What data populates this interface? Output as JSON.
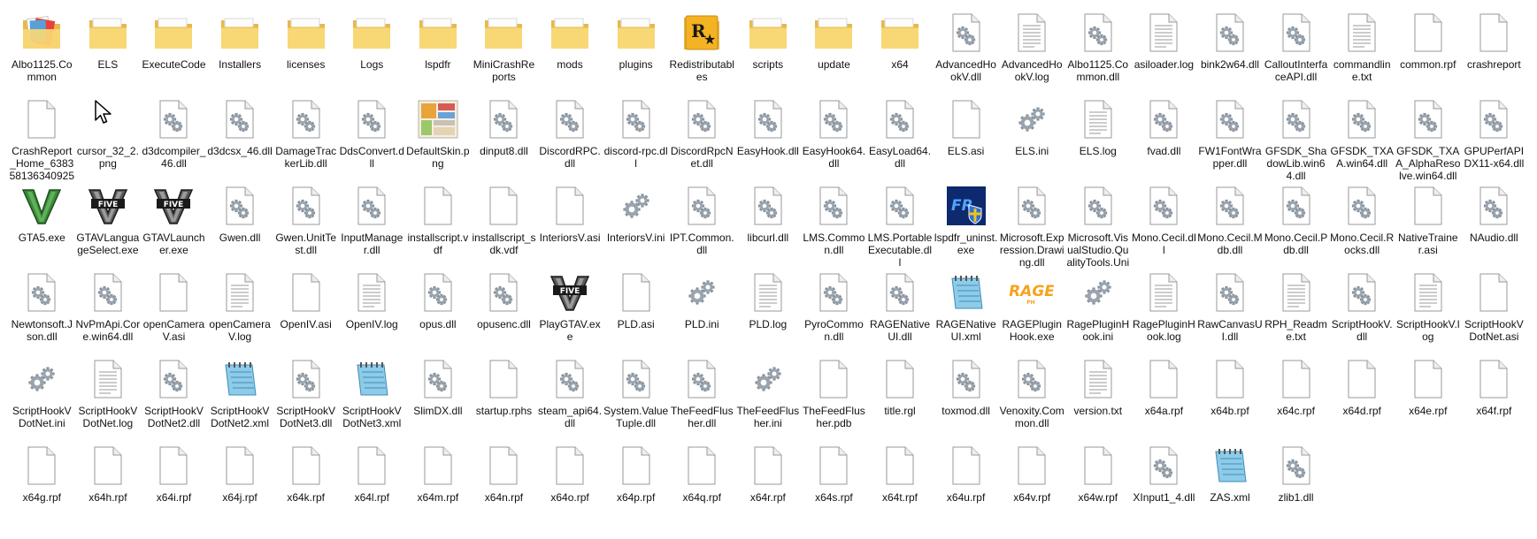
{
  "window": {
    "view": "Large icons"
  },
  "files": [
    {
      "name": "Albo1125.Common",
      "icon": "folder-docs-icon"
    },
    {
      "name": "ELS",
      "icon": "folder-icon"
    },
    {
      "name": "ExecuteCode",
      "icon": "folder-icon"
    },
    {
      "name": "Installers",
      "icon": "folder-icon"
    },
    {
      "name": "licenses",
      "icon": "folder-icon"
    },
    {
      "name": "Logs",
      "icon": "folder-icon"
    },
    {
      "name": "lspdfr",
      "icon": "folder-icon"
    },
    {
      "name": "MiniCrashReports",
      "icon": "folder-icon"
    },
    {
      "name": "mods",
      "icon": "folder-icon"
    },
    {
      "name": "plugins",
      "icon": "folder-icon"
    },
    {
      "name": "Redistributables",
      "icon": "rockstar-folder-icon"
    },
    {
      "name": "scripts",
      "icon": "folder-icon"
    },
    {
      "name": "update",
      "icon": "folder-icon"
    },
    {
      "name": "x64",
      "icon": "folder-icon"
    },
    {
      "name": "AdvancedHookV.dll",
      "icon": "dll-file-icon"
    },
    {
      "name": "AdvancedHookV.log",
      "icon": "text-file-icon"
    },
    {
      "name": "Albo1125.Common.dll",
      "icon": "dll-file-icon"
    },
    {
      "name": "asiloader.log",
      "icon": "text-file-icon"
    },
    {
      "name": "bink2w64.dll",
      "icon": "dll-file-icon"
    },
    {
      "name": "CalloutInterfaceAPI.dll",
      "icon": "dll-file-icon"
    },
    {
      "name": "commandline.txt",
      "icon": "text-file-icon"
    },
    {
      "name": "common.rpf",
      "icon": "blank-file-icon"
    },
    {
      "name": "crashreport",
      "icon": "blank-file-icon"
    },
    {
      "name": "CrashReport_Home_638358136340925501.rcr",
      "icon": "blank-file-icon"
    },
    {
      "name": "cursor_32_2.png",
      "icon": "cursor-image-icon"
    },
    {
      "name": "d3dcompiler_46.dll",
      "icon": "dll-file-icon"
    },
    {
      "name": "d3dcsx_46.dll",
      "icon": "dll-file-icon"
    },
    {
      "name": "DamageTrackerLib.dll",
      "icon": "dll-file-icon"
    },
    {
      "name": "DdsConvert.dll",
      "icon": "dll-file-icon"
    },
    {
      "name": "DefaultSkin.png",
      "icon": "image-thumbnail-icon"
    },
    {
      "name": "dinput8.dll",
      "icon": "dll-file-icon"
    },
    {
      "name": "DiscordRPC.dll",
      "icon": "dll-file-icon"
    },
    {
      "name": "discord-rpc.dll",
      "icon": "dll-file-icon"
    },
    {
      "name": "DiscordRpcNet.dll",
      "icon": "dll-file-icon"
    },
    {
      "name": "EasyHook.dll",
      "icon": "dll-file-icon"
    },
    {
      "name": "EasyHook64.dll",
      "icon": "dll-file-icon"
    },
    {
      "name": "EasyLoad64.dll",
      "icon": "dll-file-icon"
    },
    {
      "name": "ELS.asi",
      "icon": "blank-file-icon"
    },
    {
      "name": "ELS.ini",
      "icon": "settings-file-icon"
    },
    {
      "name": "ELS.log",
      "icon": "text-file-icon"
    },
    {
      "name": "fvad.dll",
      "icon": "dll-file-icon"
    },
    {
      "name": "FW1FontWrapper.dll",
      "icon": "dll-file-icon"
    },
    {
      "name": "GFSDK_ShadowLib.win64.dll",
      "icon": "dll-file-icon"
    },
    {
      "name": "GFSDK_TXAA.win64.dll",
      "icon": "dll-file-icon"
    },
    {
      "name": "GFSDK_TXAA_AlphaResolve.win64.dll",
      "icon": "dll-file-icon"
    },
    {
      "name": "GPUPerfAPIDX11-x64.dll",
      "icon": "dll-file-icon"
    },
    {
      "name": "GTA5.exe",
      "icon": "gta-v-icon"
    },
    {
      "name": "GTAVLanguageSelect.exe",
      "icon": "gta-five-icon"
    },
    {
      "name": "GTAVLauncher.exe",
      "icon": "gta-five-icon"
    },
    {
      "name": "Gwen.dll",
      "icon": "dll-file-icon"
    },
    {
      "name": "Gwen.UnitTest.dll",
      "icon": "dll-file-icon"
    },
    {
      "name": "InputManager.dll",
      "icon": "dll-file-icon"
    },
    {
      "name": "installscript.vdf",
      "icon": "blank-file-icon"
    },
    {
      "name": "installscript_sdk.vdf",
      "icon": "blank-file-icon"
    },
    {
      "name": "InteriorsV.asi",
      "icon": "blank-file-icon"
    },
    {
      "name": "InteriorsV.ini",
      "icon": "settings-file-icon"
    },
    {
      "name": "IPT.Common.dll",
      "icon": "dll-file-icon"
    },
    {
      "name": "libcurl.dll",
      "icon": "dll-file-icon"
    },
    {
      "name": "LMS.Common.dll",
      "icon": "dll-file-icon"
    },
    {
      "name": "LMS.PortableExecutable.dll",
      "icon": "dll-file-icon"
    },
    {
      "name": "lspdfr_uninst.exe",
      "icon": "lspdfr-uninstaller-icon"
    },
    {
      "name": "Microsoft.Expression.Drawing.dll",
      "icon": "dll-file-icon"
    },
    {
      "name": "Microsoft.VisualStudio.QualityTools.UnitTest...",
      "icon": "dll-file-icon"
    },
    {
      "name": "Mono.Cecil.dll",
      "icon": "dll-file-icon"
    },
    {
      "name": "Mono.Cecil.Mdb.dll",
      "icon": "dll-file-icon"
    },
    {
      "name": "Mono.Cecil.Pdb.dll",
      "icon": "dll-file-icon"
    },
    {
      "name": "Mono.Cecil.Rocks.dll",
      "icon": "dll-file-icon"
    },
    {
      "name": "NativeTrainer.asi",
      "icon": "blank-file-icon"
    },
    {
      "name": "NAudio.dll",
      "icon": "dll-file-icon"
    },
    {
      "name": "Newtonsoft.Json.dll",
      "icon": "dll-file-icon"
    },
    {
      "name": "NvPmApi.Core.win64.dll",
      "icon": "dll-file-icon"
    },
    {
      "name": "openCameraV.asi",
      "icon": "blank-file-icon"
    },
    {
      "name": "openCameraV.log",
      "icon": "text-file-icon"
    },
    {
      "name": "OpenIV.asi",
      "icon": "blank-file-icon"
    },
    {
      "name": "OpenIV.log",
      "icon": "text-file-icon"
    },
    {
      "name": "opus.dll",
      "icon": "dll-file-icon"
    },
    {
      "name": "opusenc.dll",
      "icon": "dll-file-icon"
    },
    {
      "name": "PlayGTAV.exe",
      "icon": "gta-five-icon"
    },
    {
      "name": "PLD.asi",
      "icon": "blank-file-icon"
    },
    {
      "name": "PLD.ini",
      "icon": "settings-file-icon"
    },
    {
      "name": "PLD.log",
      "icon": "text-file-icon"
    },
    {
      "name": "PyroCommon.dll",
      "icon": "dll-file-icon"
    },
    {
      "name": "RAGENativeUI.dll",
      "icon": "dll-file-icon"
    },
    {
      "name": "RAGENativeUI.xml",
      "icon": "notepad-icon"
    },
    {
      "name": "RAGEPluginHook.exe",
      "icon": "rage-logo-icon"
    },
    {
      "name": "RagePluginHook.ini",
      "icon": "settings-file-icon"
    },
    {
      "name": "RagePluginHook.log",
      "icon": "text-file-icon"
    },
    {
      "name": "RawCanvasUI.dll",
      "icon": "dll-file-icon"
    },
    {
      "name": "RPH_Readme.txt",
      "icon": "text-file-icon"
    },
    {
      "name": "ScriptHookV.dll",
      "icon": "dll-file-icon"
    },
    {
      "name": "ScriptHookV.log",
      "icon": "text-file-icon"
    },
    {
      "name": "ScriptHookVDotNet.asi",
      "icon": "blank-file-icon"
    },
    {
      "name": "ScriptHookVDotNet.ini",
      "icon": "settings-file-icon"
    },
    {
      "name": "ScriptHookVDotNet.log",
      "icon": "text-file-icon"
    },
    {
      "name": "ScriptHookVDotNet2.dll",
      "icon": "dll-file-icon"
    },
    {
      "name": "ScriptHookVDotNet2.xml",
      "icon": "notepad-icon"
    },
    {
      "name": "ScriptHookVDotNet3.dll",
      "icon": "dll-file-icon"
    },
    {
      "name": "ScriptHookVDotNet3.xml",
      "icon": "notepad-icon"
    },
    {
      "name": "SlimDX.dll",
      "icon": "dll-file-icon"
    },
    {
      "name": "startup.rphs",
      "icon": "blank-file-icon"
    },
    {
      "name": "steam_api64.dll",
      "icon": "dll-file-icon"
    },
    {
      "name": "System.ValueTuple.dll",
      "icon": "dll-file-icon"
    },
    {
      "name": "TheFeedFlusher.dll",
      "icon": "dll-file-icon"
    },
    {
      "name": "TheFeedFlusher.ini",
      "icon": "settings-file-icon"
    },
    {
      "name": "TheFeedFlusher.pdb",
      "icon": "blank-file-icon"
    },
    {
      "name": "title.rgl",
      "icon": "blank-file-icon"
    },
    {
      "name": "toxmod.dll",
      "icon": "dll-file-icon"
    },
    {
      "name": "Venoxity.Common.dll",
      "icon": "dll-file-icon"
    },
    {
      "name": "version.txt",
      "icon": "text-file-icon"
    },
    {
      "name": "x64a.rpf",
      "icon": "blank-file-icon"
    },
    {
      "name": "x64b.rpf",
      "icon": "blank-file-icon"
    },
    {
      "name": "x64c.rpf",
      "icon": "blank-file-icon"
    },
    {
      "name": "x64d.rpf",
      "icon": "blank-file-icon"
    },
    {
      "name": "x64e.rpf",
      "icon": "blank-file-icon"
    },
    {
      "name": "x64f.rpf",
      "icon": "blank-file-icon"
    },
    {
      "name": "x64g.rpf",
      "icon": "blank-file-icon"
    },
    {
      "name": "x64h.rpf",
      "icon": "blank-file-icon"
    },
    {
      "name": "x64i.rpf",
      "icon": "blank-file-icon"
    },
    {
      "name": "x64j.rpf",
      "icon": "blank-file-icon"
    },
    {
      "name": "x64k.rpf",
      "icon": "blank-file-icon"
    },
    {
      "name": "x64l.rpf",
      "icon": "blank-file-icon"
    },
    {
      "name": "x64m.rpf",
      "icon": "blank-file-icon"
    },
    {
      "name": "x64n.rpf",
      "icon": "blank-file-icon"
    },
    {
      "name": "x64o.rpf",
      "icon": "blank-file-icon"
    },
    {
      "name": "x64p.rpf",
      "icon": "blank-file-icon"
    },
    {
      "name": "x64q.rpf",
      "icon": "blank-file-icon"
    },
    {
      "name": "x64r.rpf",
      "icon": "blank-file-icon"
    },
    {
      "name": "x64s.rpf",
      "icon": "blank-file-icon"
    },
    {
      "name": "x64t.rpf",
      "icon": "blank-file-icon"
    },
    {
      "name": "x64u.rpf",
      "icon": "blank-file-icon"
    },
    {
      "name": "x64v.rpf",
      "icon": "blank-file-icon"
    },
    {
      "name": "x64w.rpf",
      "icon": "blank-file-icon"
    },
    {
      "name": "XInput1_4.dll",
      "icon": "dll-file-icon"
    },
    {
      "name": "ZAS.xml",
      "icon": "notepad-icon"
    },
    {
      "name": "zlib1.dll",
      "icon": "dll-file-icon"
    }
  ]
}
